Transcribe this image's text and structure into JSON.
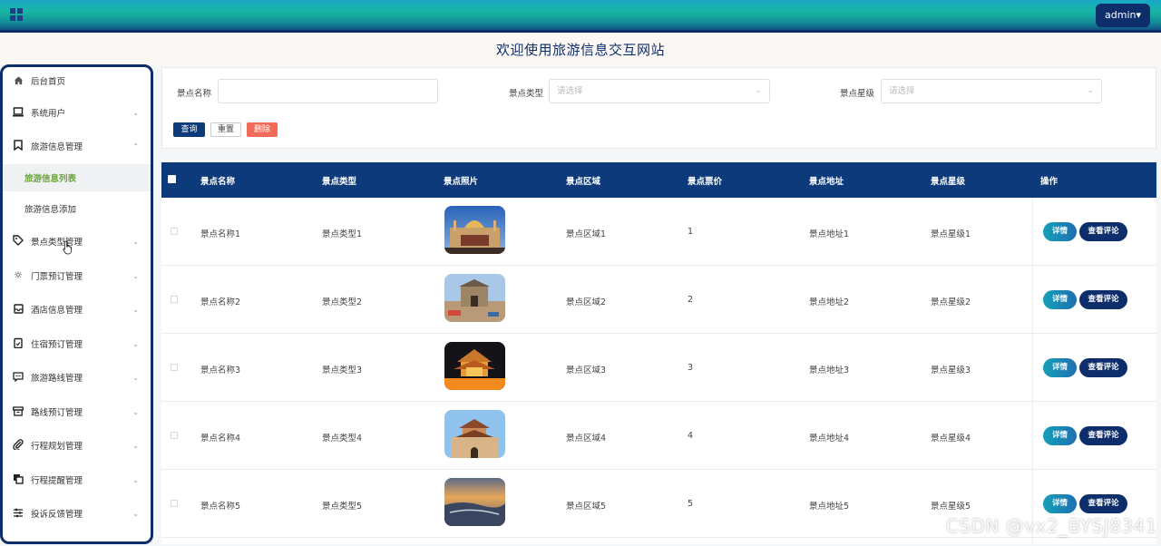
{
  "header": {
    "menu_icon": "grid-icon",
    "user_label": "admin▾",
    "site_title": "欢迎使用旅游信息交互网站",
    "accent_color": "#0d2d6b"
  },
  "sidebar": {
    "items": [
      {
        "label": "后台首页",
        "icon": "home-icon"
      },
      {
        "label": "系统用户",
        "icon": "laptop-icon"
      },
      {
        "label": "旅游信息管理",
        "icon": "bookmark-icon",
        "expanded": true
      },
      {
        "label": "景点类型管理",
        "icon": "tag-icon"
      },
      {
        "label": "门票预订管理",
        "icon": "sun-icon"
      },
      {
        "label": "酒店信息管理",
        "icon": "inbox-icon"
      },
      {
        "label": "住宿预订管理",
        "icon": "clipboard-check-icon"
      },
      {
        "label": "旅游路线管理",
        "icon": "message-icon"
      },
      {
        "label": "路线预订管理",
        "icon": "archive-icon"
      },
      {
        "label": "行程规划管理",
        "icon": "paperclip-icon"
      },
      {
        "label": "行程提醒管理",
        "icon": "copy-icon"
      },
      {
        "label": "投诉反馈管理",
        "icon": "sliders-icon"
      }
    ],
    "subitems": [
      {
        "label": "旅游信息列表",
        "active": true
      },
      {
        "label": "旅游信息添加",
        "active": false
      }
    ]
  },
  "search": {
    "name_label": "景点名称",
    "name_value": "",
    "type_label": "景点类型",
    "type_placeholder": "请选择",
    "star_label": "景点星级",
    "star_placeholder": "请选择",
    "query_button": "查询",
    "reset_button": "重置",
    "delete_button": "删除"
  },
  "table": {
    "columns": [
      "景点名称",
      "景点类型",
      "景点照片",
      "景点区域",
      "景点票价",
      "景点地址",
      "景点星级",
      "操作"
    ],
    "detail_button": "详情",
    "review_button": "查看评论",
    "rows": [
      {
        "name": "景点名称1",
        "type": "景点类型1",
        "area": "景点区域1",
        "price": "1",
        "address": "景点地址1",
        "star": "景点星级1"
      },
      {
        "name": "景点名称2",
        "type": "景点类型2",
        "area": "景点区域2",
        "price": "2",
        "address": "景点地址2",
        "star": "景点星级2"
      },
      {
        "name": "景点名称3",
        "type": "景点类型3",
        "area": "景点区域3",
        "price": "3",
        "address": "景点地址3",
        "star": "景点星级3"
      },
      {
        "name": "景点名称4",
        "type": "景点类型4",
        "area": "景点区域4",
        "price": "4",
        "address": "景点地址4",
        "star": "景点星级4"
      },
      {
        "name": "景点名称5",
        "type": "景点类型5",
        "area": "景点区域5",
        "price": "5",
        "address": "景点地址5",
        "star": "景点星级5"
      }
    ]
  },
  "watermark": "CSDN @vx2_BYSJ8341"
}
